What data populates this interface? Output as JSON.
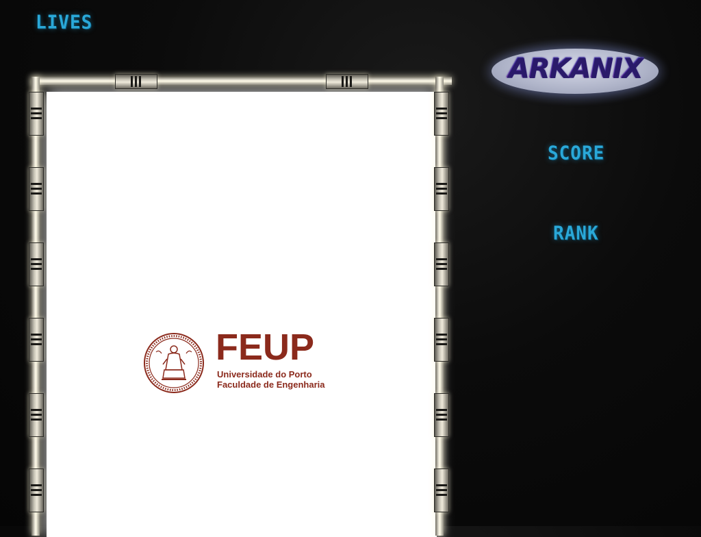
{
  "hud": {
    "lives_label": "LIVES",
    "score_label": "SCORE",
    "rank_label": "RANK"
  },
  "logo": {
    "text": "ARKANIX"
  },
  "splash": {
    "title": "FEUP",
    "subtitle_line1": "Universidade do Porto",
    "subtitle_line2": "Faculdade de Engenharia"
  },
  "colors": {
    "hud_text": "#2aa8d8",
    "feup_brand": "#8b2a1c",
    "background": "#0b0b0b"
  },
  "icons": {
    "seal": "university-seal-icon"
  }
}
